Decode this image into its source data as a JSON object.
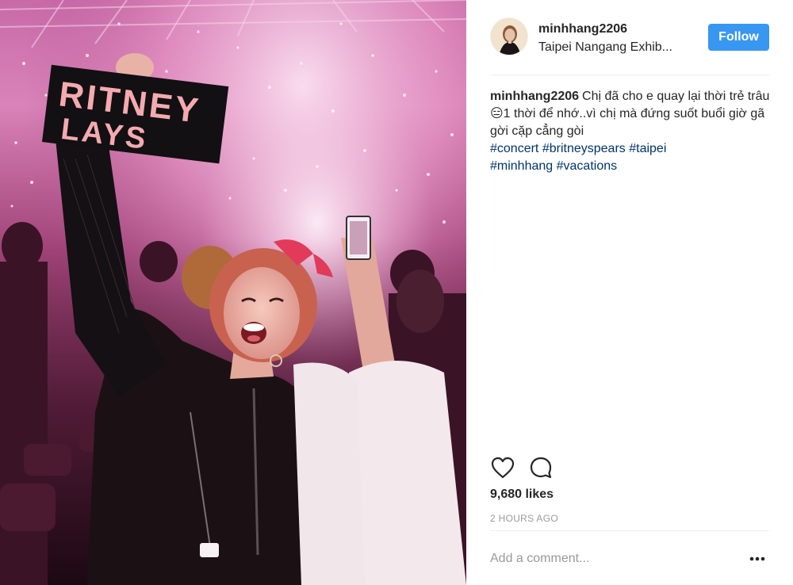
{
  "post": {
    "username": "minhhang2206",
    "location": "Taipei Nangang Exhib...",
    "follow_label": "Follow",
    "caption": {
      "username": "minhhang2206",
      "text": "Chị đã cho e quay lại thời trẻ trâu😑1 thời để nhớ..vì chị mà đứng suốt buổi giờ gã gời cặp cẳng gòi",
      "hashtags": [
        "#concert",
        "#britneyspears",
        "#taipei",
        "#minhhang",
        "#vacations"
      ]
    },
    "likes": "9,680 likes",
    "timestamp": "2 HOURS AGO",
    "comment_placeholder": "Add a comment...",
    "more_glyph": "•••"
  },
  "photo": {
    "sign_line1": "RITNEY",
    "sign_line2": "LAYS"
  },
  "icons": {
    "like": "heart-icon",
    "comment": "comment-bubble-icon",
    "more": "more-options-icon"
  },
  "colors": {
    "follow_bg": "#3897f0",
    "hashtag": "#003569",
    "timestamp": "#999999",
    "divider": "#efefef"
  }
}
